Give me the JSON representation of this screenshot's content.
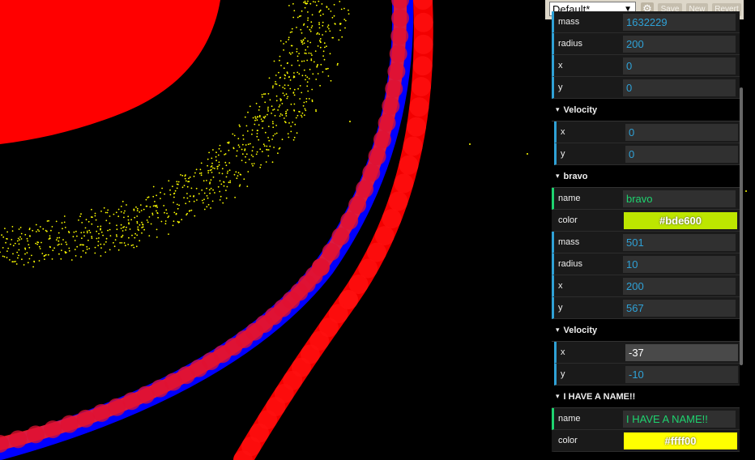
{
  "gui": {
    "preset": "Default*",
    "buttons": {
      "save": "Save",
      "new": "New",
      "revert": "Revert"
    },
    "rows": [
      {
        "kind": "num",
        "label": "mass",
        "value": "1632229",
        "top": 0
      },
      {
        "kind": "num",
        "label": "radius",
        "value": "200"
      },
      {
        "kind": "num",
        "label": "x",
        "value": "0"
      },
      {
        "kind": "num",
        "label": "y",
        "value": "0"
      },
      {
        "kind": "folder",
        "label": "Velocity"
      },
      {
        "kind": "num",
        "label": "x",
        "value": "0",
        "indent": true
      },
      {
        "kind": "num",
        "label": "y",
        "value": "0",
        "indent": true
      },
      {
        "kind": "folder",
        "label": "bravo"
      },
      {
        "kind": "str",
        "label": "name",
        "value": "bravo"
      },
      {
        "kind": "col",
        "label": "color",
        "value": "#bde600",
        "color": "#bde600"
      },
      {
        "kind": "num",
        "label": "mass",
        "value": "501"
      },
      {
        "kind": "num",
        "label": "radius",
        "value": "10"
      },
      {
        "kind": "num",
        "label": "x",
        "value": "200"
      },
      {
        "kind": "num",
        "label": "y",
        "value": "567"
      },
      {
        "kind": "folder",
        "label": "Velocity"
      },
      {
        "kind": "num",
        "label": "x",
        "value": "-37",
        "indent": true,
        "active": true
      },
      {
        "kind": "num",
        "label": "y",
        "value": "-10",
        "indent": true
      },
      {
        "kind": "folder",
        "label": "I HAVE A NAME!!"
      },
      {
        "kind": "str",
        "label": "name",
        "value": "I HAVE A NAME!!"
      },
      {
        "kind": "col",
        "label": "color",
        "value": "#ffff00",
        "color": "#ffff00"
      }
    ]
  },
  "colors": {
    "planet": "#ff0000",
    "trail_blue": "#0000ff",
    "trail_red": "#ff0000",
    "particles": "#ffff00"
  }
}
